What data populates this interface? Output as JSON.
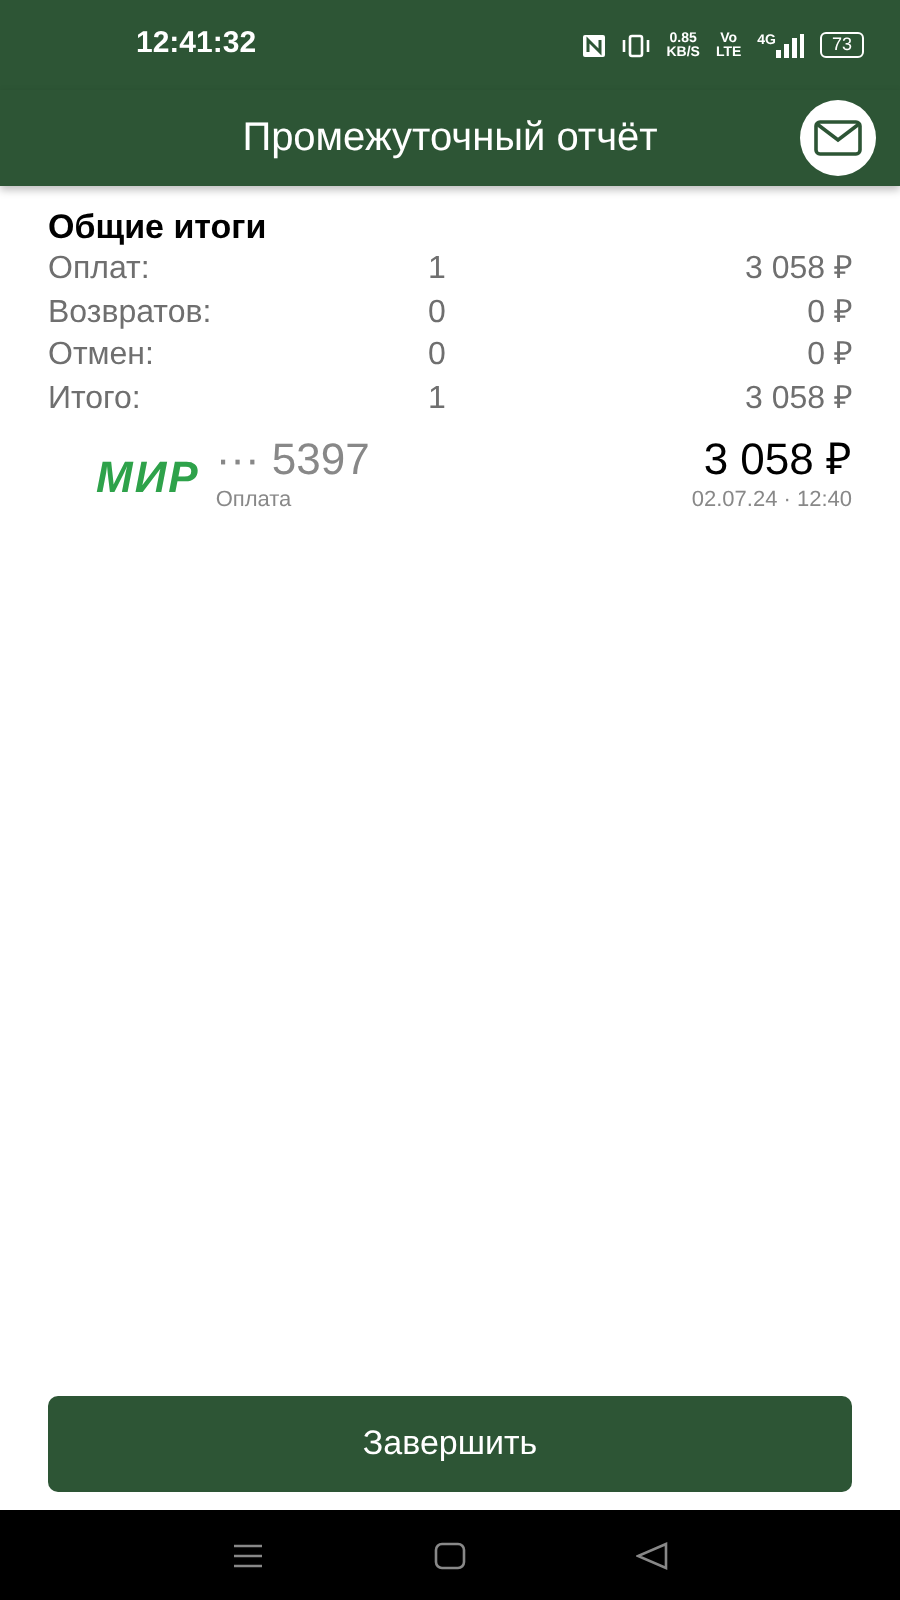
{
  "status_bar": {
    "time": "12:41:32",
    "speed": "0.85",
    "speed_unit": "KB/S",
    "volte": "Vo",
    "lte": "LTE",
    "network": "4G",
    "battery": "73"
  },
  "header": {
    "title": "Промежуточный отчёт"
  },
  "summary": {
    "title": "Общие итоги",
    "rows": [
      {
        "label": "Оплат:",
        "count": "1",
        "amount": "3 058 ₽"
      },
      {
        "label": "Возвратов:",
        "count": "0",
        "amount": "0 ₽"
      },
      {
        "label": "Отмен:",
        "count": "0",
        "amount": "0 ₽"
      },
      {
        "label": "Итого:",
        "count": "1",
        "amount": "3 058 ₽"
      }
    ]
  },
  "transactions": [
    {
      "logo": "МИР",
      "card": "··· 5397",
      "type": "Оплата",
      "amount": "3 058 ₽",
      "datetime": "02.07.24 · 12:40"
    }
  ],
  "finish_button": "Завершить"
}
